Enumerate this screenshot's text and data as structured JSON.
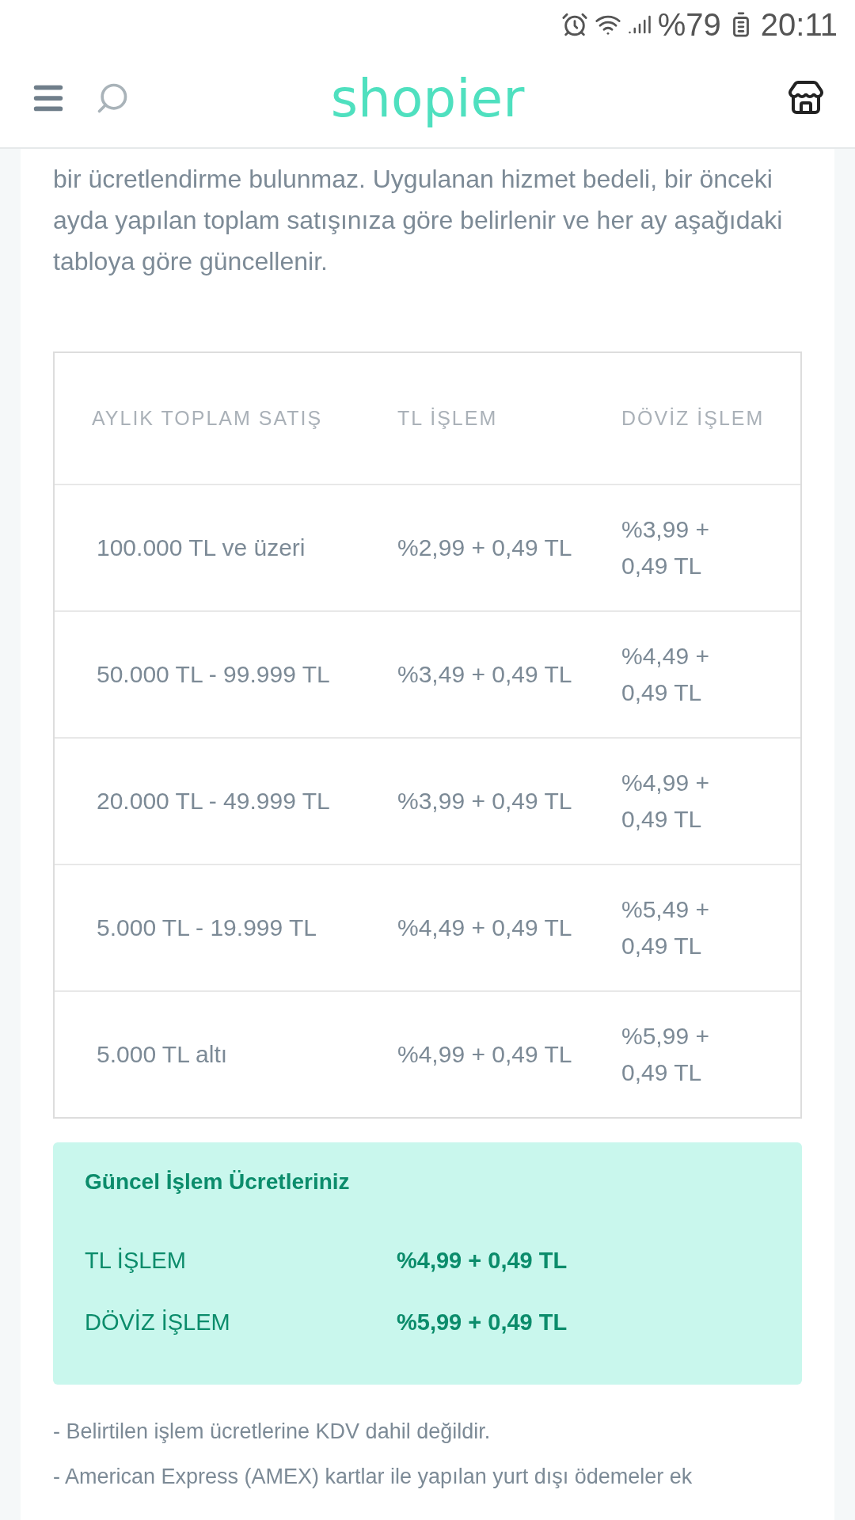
{
  "status_bar": {
    "battery": "%79",
    "time": "20:11"
  },
  "header": {
    "logo": "shopier"
  },
  "intro": "bir ücretlendirme bulunmaz. Uygulanan hizmet bedeli, bir önceki ayda yapılan toplam satışınıza göre belirlenir ve her ay aşağıdaki tabloya göre güncellenir.",
  "table": {
    "columns": [
      "AYLIK TOPLAM SATIŞ",
      "TL İŞLEM",
      "DÖVİZ İŞLEM"
    ],
    "rows": [
      [
        "100.000 TL ve üzeri",
        "%2,99 + 0,49 TL",
        "%3,99 + 0,49 TL"
      ],
      [
        "50.000 TL - 99.999 TL",
        "%3,49 + 0,49 TL",
        "%4,49 + 0,49 TL"
      ],
      [
        "20.000 TL - 49.999 TL",
        "%3,99 + 0,49 TL",
        "%4,99 + 0,49 TL"
      ],
      [
        "5.000 TL - 19.999 TL",
        "%4,49 + 0,49 TL",
        "%5,49 + 0,49 TL"
      ],
      [
        "5.000 TL altı",
        "%4,99 + 0,49 TL",
        "%5,99 + 0,49 TL"
      ]
    ]
  },
  "current_fees": {
    "title": "Güncel İşlem Ücretleriniz",
    "rows": [
      {
        "label": "TL İŞLEM",
        "value": "%4,99 + 0,49 TL"
      },
      {
        "label": "DÖVİZ İŞLEM",
        "value": "%5,99 + 0,49 TL"
      }
    ]
  },
  "notes": [
    "- Belirtilen işlem ücretlerine KDV dahil değildir.",
    "- American Express (AMEX) kartlar ile yapılan yurt dışı ödemeler ek"
  ]
}
